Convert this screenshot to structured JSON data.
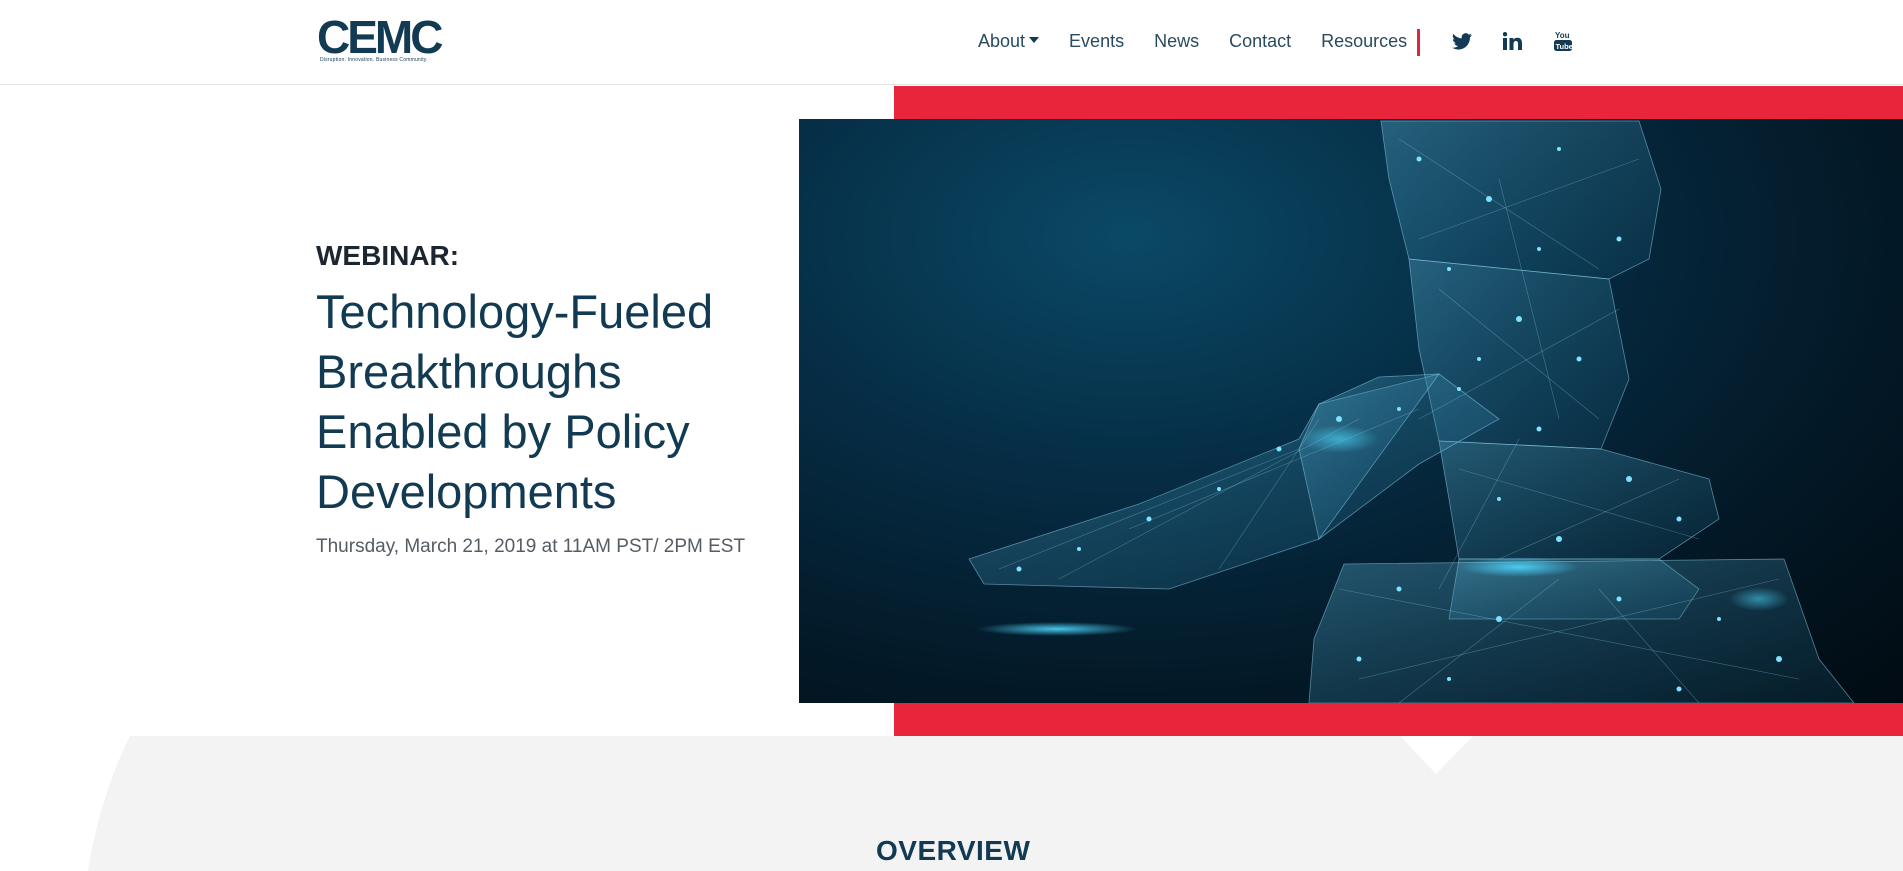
{
  "header": {
    "logo_text": "CEMC",
    "logo_tagline": "Disruption. Innovation. Business Community.",
    "nav": [
      {
        "label": "About",
        "has_dropdown": true
      },
      {
        "label": "Events"
      },
      {
        "label": "News"
      },
      {
        "label": "Contact"
      },
      {
        "label": "Resources"
      }
    ],
    "social": [
      "twitter-icon",
      "linkedin-icon",
      "youtube-icon"
    ]
  },
  "hero": {
    "eyebrow": "WEBINAR:",
    "title": "Technology-Fueled Breakthroughs Enabled by Policy Developments",
    "date": "Thursday, March 21, 2019 at 11AM PST/ 2PM EST",
    "image_icon": "gavel-network-illustration"
  },
  "overview": {
    "heading": "OVERVIEW"
  },
  "colors": {
    "primary_navy": "#123a52",
    "accent_red": "#e8253a",
    "background_gray": "#f3f3f3"
  }
}
